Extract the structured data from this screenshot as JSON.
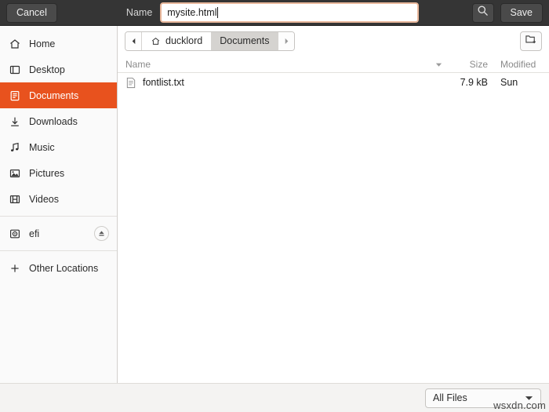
{
  "header": {
    "cancel_label": "Cancel",
    "name_label": "Name",
    "save_label": "Save",
    "search_icon": "search-icon",
    "filename_input": {
      "value": "mysite.html",
      "placeholder": "Name"
    },
    "bg_color": "#353535",
    "focus_border_color": "#e8b79b"
  },
  "sidebar": {
    "accent_color": "#e8521e",
    "items": [
      {
        "label": "Home",
        "icon": "home-icon",
        "selected": false
      },
      {
        "label": "Desktop",
        "icon": "desktop-icon",
        "selected": false
      },
      {
        "label": "Documents",
        "icon": "documents-icon",
        "selected": true
      },
      {
        "label": "Downloads",
        "icon": "downloads-icon",
        "selected": false
      },
      {
        "label": "Music",
        "icon": "music-icon",
        "selected": false
      },
      {
        "label": "Pictures",
        "icon": "pictures-icon",
        "selected": false
      },
      {
        "label": "Videos",
        "icon": "videos-icon",
        "selected": false
      },
      {
        "label": "efi",
        "icon": "drive-icon",
        "selected": false,
        "eject": true
      },
      {
        "label": "Other Locations",
        "icon": "plus-icon",
        "selected": false
      }
    ]
  },
  "pathbar": {
    "back_icon": "chevron-left-icon",
    "forward_icon": "chevron-right-icon",
    "crumbs": [
      {
        "label": "ducklord",
        "icon": "home-icon",
        "active": false
      },
      {
        "label": "Documents",
        "icon": "",
        "active": true
      }
    ],
    "new_folder_icon": "new-folder-icon"
  },
  "filelist": {
    "columns": [
      {
        "label": "Name",
        "sorted": true,
        "sort_dir": "descending"
      },
      {
        "label": "Size",
        "sorted": false
      },
      {
        "label": "Modified",
        "sorted": false
      }
    ],
    "rows": [
      {
        "name": "fontlist.txt",
        "size": "7.9 kB",
        "modified": "Sun",
        "icon": "text-file-icon"
      }
    ]
  },
  "bottombar": {
    "filter_label": "All Files",
    "dropdown_icon": "chevron-down-icon"
  },
  "watermark": {
    "text": "wsxdn.com"
  }
}
